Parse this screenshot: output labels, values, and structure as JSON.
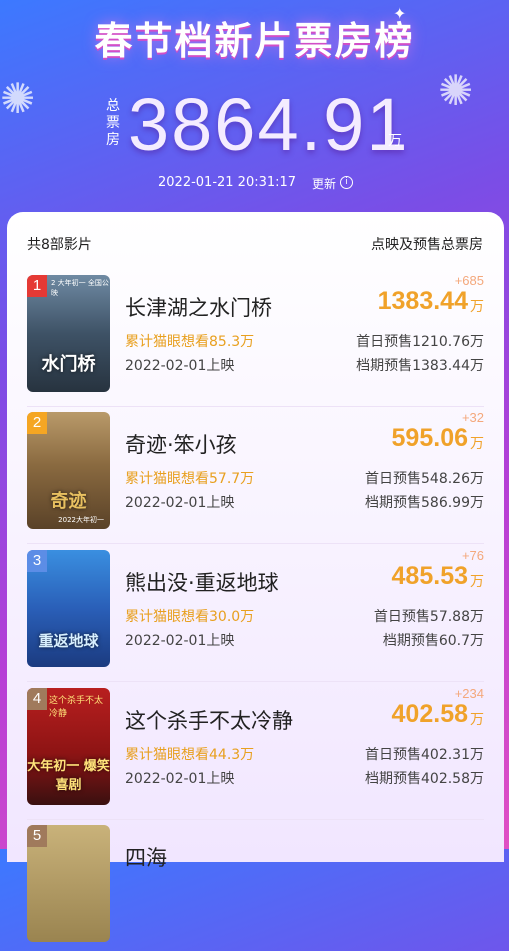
{
  "header": {
    "title": "春节档新片票房榜",
    "total_label": "总票房",
    "total_value": "3864.91",
    "total_unit": "万",
    "timestamp": "2022-01-21  20:31:17",
    "update_label": "更新",
    "info_icon": "i"
  },
  "list": {
    "count_label": "共8部影片",
    "sum_label": "点映及预售总票房"
  },
  "movies": [
    {
      "rank": "1",
      "rank_color": "#e53935",
      "poster_text": "水门桥",
      "poster_topline": "2 大年初一 全国公映",
      "poster_date": "",
      "title": "长津湖之水门桥",
      "want": "累计猫眼想看85.3万",
      "release": "2022-02-01上映",
      "delta": "+685",
      "gross": "1383.44",
      "unit": "万",
      "first_day": "首日预售1210.76万",
      "period": "档期预售1383.44万"
    },
    {
      "rank": "2",
      "rank_color": "#f5a623",
      "poster_text": "奇迹",
      "poster_topline": "",
      "poster_date": "2022大年初一",
      "title": "奇迹·笨小孩",
      "want": "累计猫眼想看57.7万",
      "release": "2022-02-01上映",
      "delta": "+32",
      "gross": "595.06",
      "unit": "万",
      "first_day": "首日预售548.26万",
      "period": "档期预售586.99万"
    },
    {
      "rank": "3",
      "rank_color": "#5c8de6",
      "poster_text": "重返地球",
      "poster_topline": "",
      "poster_date": "",
      "title": "熊出没·重返地球",
      "want": "累计猫眼想看30.0万",
      "release": "2022-02-01上映",
      "delta": "+76",
      "gross": "485.53",
      "unit": "万",
      "first_day": "首日预售57.88万",
      "period": "档期预售60.7万"
    },
    {
      "rank": "4",
      "rank_color": "#a07a5c",
      "poster_text": "大年初一 爆笑喜剧",
      "poster_topline": "这个杀手不太冷静",
      "poster_date": "",
      "title": "这个杀手不太冷静",
      "want": "累计猫眼想看44.3万",
      "release": "2022-02-01上映",
      "delta": "+234",
      "gross": "402.58",
      "unit": "万",
      "first_day": "首日预售402.31万",
      "period": "档期预售402.58万"
    },
    {
      "rank": "5",
      "rank_color": "#a07a5c",
      "poster_text": "",
      "poster_topline": "",
      "poster_date": "",
      "title": "四海",
      "want": "",
      "release": "",
      "delta": "",
      "gross": "",
      "unit": "",
      "first_day": "",
      "period": ""
    }
  ]
}
